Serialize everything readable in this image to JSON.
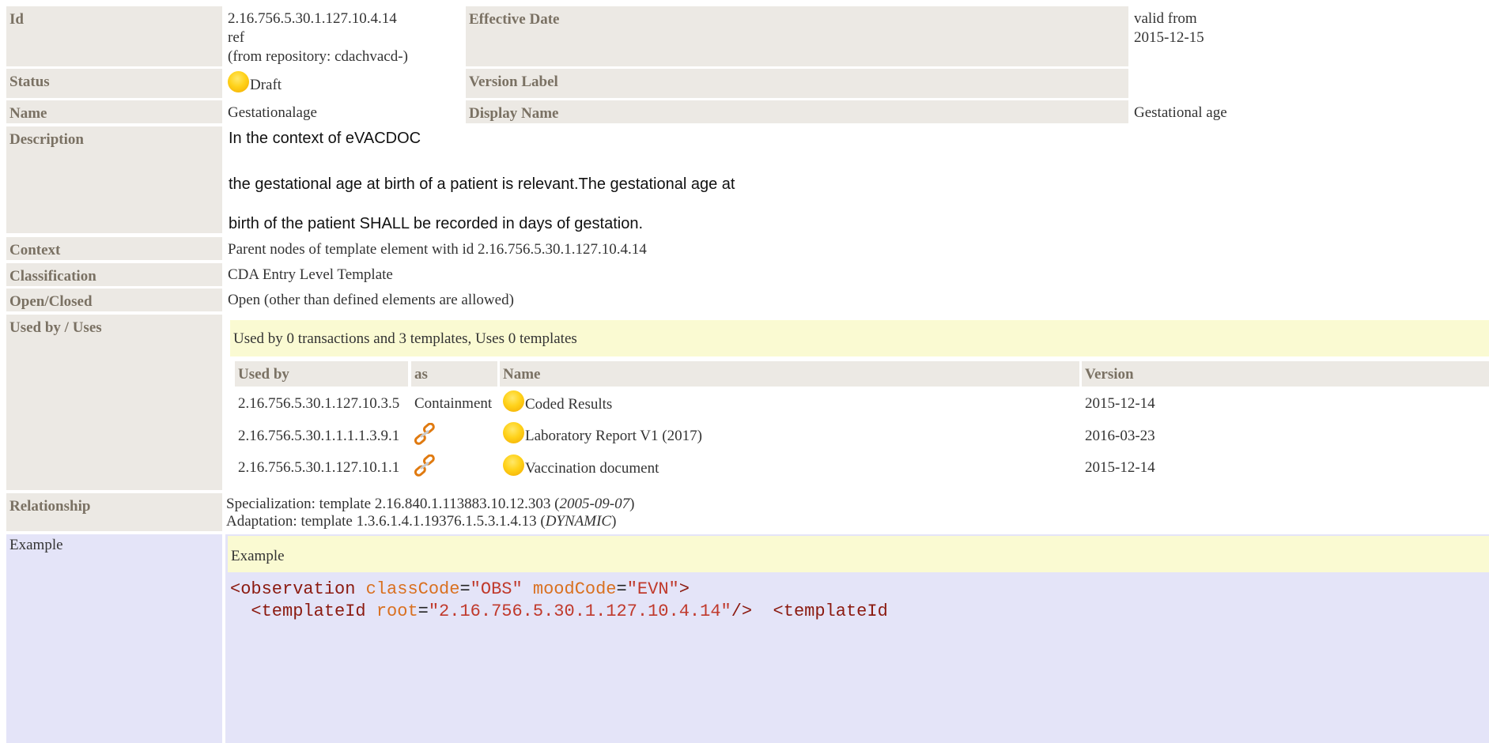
{
  "header": {
    "id_label": "Id",
    "id_value": "2.16.756.5.30.1.127.10.4.14",
    "id_ref": "ref",
    "id_repo": "(from repository: cdachvacd-)",
    "effective_label": "Effective Date",
    "effective_value_1": "valid from",
    "effective_value_2": "2015-12-15",
    "status_label": "Status",
    "status_value": "Draft",
    "version_label": "Version Label",
    "version_value": "",
    "name_label": "Name",
    "name_value": "Gestationalage",
    "display_label": "Display Name",
    "display_value": "Gestational age"
  },
  "description": {
    "label": "Description",
    "line1": "In the context of eVACDOC",
    "line2": "the gestational age at birth of a patient is relevant.The gestational age at",
    "line3": "birth of the patient SHALL be recorded in days of gestation."
  },
  "context": {
    "label": "Context",
    "value": "Parent nodes of template element with id 2.16.756.5.30.1.127.10.4.14"
  },
  "classification": {
    "label": "Classification",
    "value": "CDA Entry Level Template"
  },
  "openclosed": {
    "label": "Open/Closed",
    "value": "Open (other than defined elements are allowed)"
  },
  "usedby": {
    "label": "Used by / Uses",
    "summary": "Used by 0 transactions and 3 templates, Uses 0 templates",
    "columns": [
      "Used by",
      "as",
      "Name",
      "Version"
    ],
    "rows": [
      {
        "id": "2.16.756.5.30.1.127.10.3.5",
        "as": "Containment",
        "name": "Coded Results",
        "version": "2015-12-14",
        "icon": "status-draft-icon"
      },
      {
        "id": "2.16.756.5.30.1.1.1.1.3.9.1",
        "as": "",
        "name": "Laboratory Report V1 (2017)",
        "version": "2016-03-23",
        "icon": "link-icon"
      },
      {
        "id": "2.16.756.5.30.1.127.10.1.1",
        "as": "",
        "name": "Vaccination document",
        "version": "2015-12-14",
        "icon": "link-icon"
      }
    ]
  },
  "relationship": {
    "label": "Relationship",
    "line1_prefix": "Specialization: template 2.16.840.1.113883.10.12.303 (",
    "line1_italic": "2005-09-07",
    "line1_suffix": ")",
    "line2_prefix": "Adaptation: template 1.3.6.1.4.1.19376.1.5.3.1.4.13 (",
    "line2_italic": "DYNAMIC",
    "line2_suffix": ")"
  },
  "example": {
    "label": "Example",
    "header": "Example",
    "code_line1": {
      "open": "<observation ",
      "attr1": "classCode",
      "eq1": "=",
      "val1": "\"OBS\"",
      "sp": " ",
      "attr2": "moodCode",
      "eq2": "=",
      "val2": "\"EVN\"",
      "close": ">"
    },
    "code_line2": {
      "indent": "  ",
      "open": "<templateId ",
      "attr1": "root",
      "eq1": "=",
      "val1": "\"2.16.756.5.30.1.127.10.4.14\"",
      "close": "/>",
      "gap": "  ",
      "open2": "<templateId"
    }
  },
  "colors": {
    "label_bg": "#ece9e4",
    "label_text": "#7a7163",
    "example_bg": "#e4e4f8",
    "highlight_bg": "#fafad2",
    "status_draft": "#ffd21a"
  }
}
